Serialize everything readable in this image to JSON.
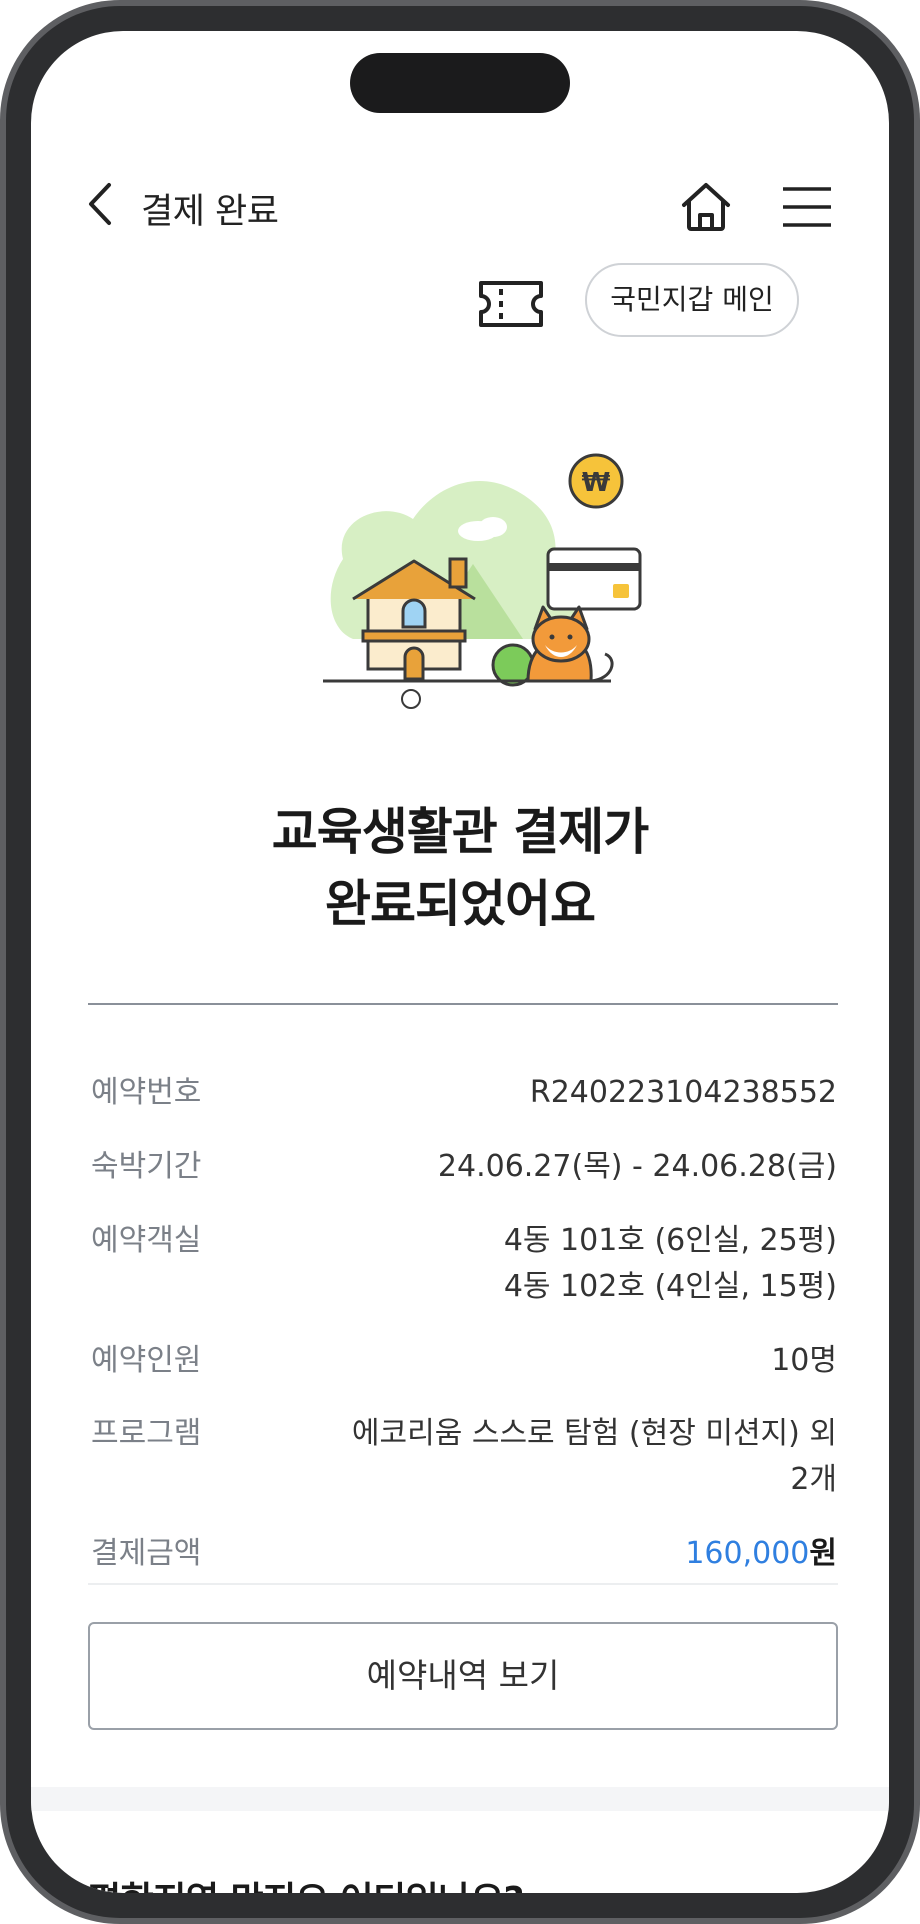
{
  "header": {
    "title": "결제 완료"
  },
  "top_actions": {
    "wallet_main_label": "국민지갑 메인"
  },
  "completion": {
    "headline_line1": "교육생활관 결제가",
    "headline_line2": "완료되었어요"
  },
  "details": [
    {
      "label": "예약번호",
      "value": "R240223104238552"
    },
    {
      "label": "숙박기간",
      "value": "24.06.27(목) - 24.06.28(금)"
    },
    {
      "label": "예약객실",
      "value": "4동 101호 (6인실, 25평)",
      "value2": "4동 102호 (4인실, 15평)"
    },
    {
      "label": "예약인원",
      "value": "10명"
    },
    {
      "label": "프로그램",
      "value": "에코리움 스스로 탐험 (현장 미션지) 외",
      "value2": "2개"
    },
    {
      "label": "결제금액",
      "amount": "160,000",
      "unit": "원"
    }
  ],
  "buttons": {
    "view_reservation": "예약내역 보기"
  },
  "bottom": {
    "heading": "편한지역 만지오 어디있나요?"
  },
  "colors": {
    "accent_blue": "#2f7fe0",
    "frame": "#2d2e30"
  },
  "icons": [
    "chevron-left-icon",
    "home-icon",
    "menu-icon",
    "ticket-icon"
  ]
}
